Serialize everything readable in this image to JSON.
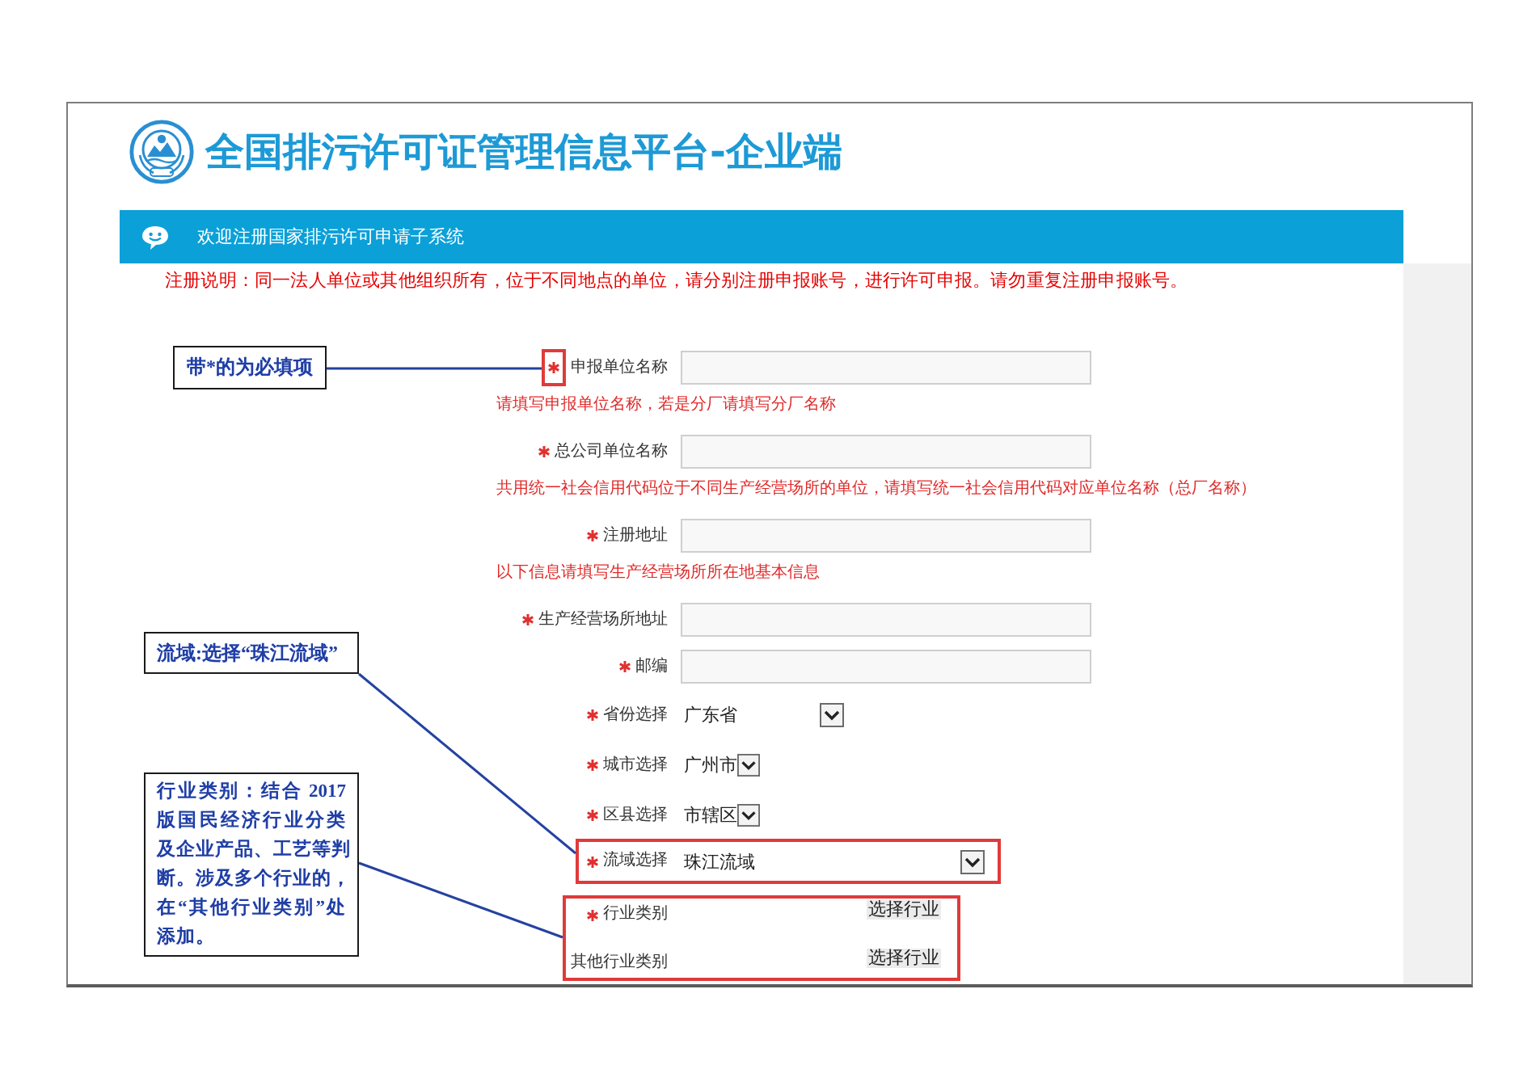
{
  "header": {
    "title": "全国排污许可证管理信息平台-企业端"
  },
  "banner": {
    "text": "欢迎注册国家排污许可申请子系统"
  },
  "notice": "注册说明：同一法人单位或其他组织所有，位于不同地点的单位，请分别注册申报账号，进行许可申报。请勿重复注册申报账号。",
  "form": {
    "items": [
      {
        "kind": "input",
        "label": "申报单位名称",
        "required": true,
        "star_highlighted": true,
        "highlighted": false
      },
      {
        "kind": "hint",
        "text": "请填写申报单位名称，若是分厂请填写分厂名称"
      },
      {
        "kind": "input",
        "label": "总公司单位名称",
        "required": true,
        "star_highlighted": false,
        "highlighted": false
      },
      {
        "kind": "hint",
        "text": "共用统一社会信用代码位于不同生产经营场所的单位，请填写统一社会信用代码对应单位名称（总厂名称）"
      },
      {
        "kind": "input",
        "label": "注册地址",
        "required": true,
        "star_highlighted": false,
        "highlighted": false
      },
      {
        "kind": "hint",
        "text": "以下信息请填写生产经营场所所在地基本信息"
      },
      {
        "kind": "input",
        "label": "生产经营场所地址",
        "required": true,
        "star_highlighted": false,
        "highlighted": false
      },
      {
        "kind": "input",
        "label": "邮编",
        "required": true,
        "star_highlighted": false,
        "highlighted": false
      },
      {
        "kind": "select",
        "label": "省份选择",
        "required": true,
        "value": "广东省",
        "star_highlighted": false,
        "highlighted": false
      },
      {
        "kind": "select",
        "label": "城市选择",
        "required": true,
        "value": "广州市",
        "star_highlighted": false,
        "highlighted": false
      },
      {
        "kind": "select",
        "label": "区县选择",
        "required": true,
        "value": "市辖区",
        "star_highlighted": false,
        "highlighted": false
      },
      {
        "kind": "select",
        "label": "流域选择",
        "required": true,
        "value": "珠江流域",
        "star_highlighted": false,
        "highlighted": true
      }
    ],
    "industry": {
      "highlighted": true,
      "rows": [
        {
          "label": "行业类别",
          "required": true,
          "button": "选择行业"
        },
        {
          "label": "其他行业类别",
          "required": false,
          "button": "选择行业"
        }
      ]
    }
  },
  "callouts": [
    {
      "lines": [
        "带*的为必填项"
      ]
    },
    {
      "lines": [
        "流域:选择“珠江流域”"
      ]
    },
    {
      "lines": [
        "行业类别：结合 2017",
        "版国民经济行业分类",
        "及企业产品、工艺等判",
        "断。涉及多个行业的，",
        "在“其他行业类别”处",
        "添加。"
      ]
    }
  ]
}
